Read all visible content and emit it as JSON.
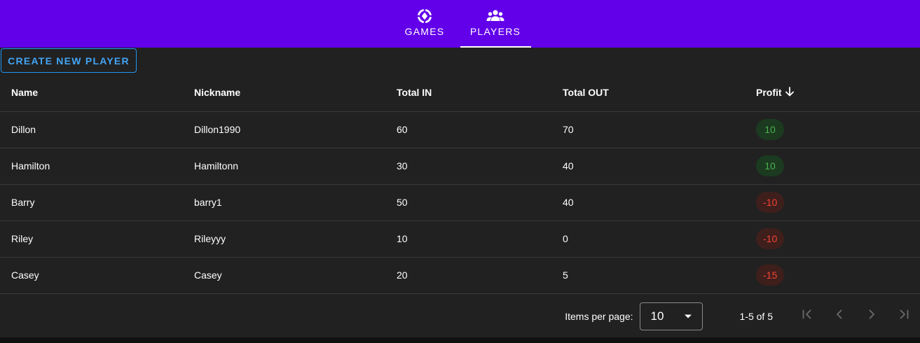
{
  "nav": {
    "tabs": [
      {
        "label": "GAMES",
        "icon": "poker-chip-icon",
        "active": false
      },
      {
        "label": "PLAYERS",
        "icon": "people-icon",
        "active": true
      }
    ]
  },
  "toolbar": {
    "create_label": "CREATE NEW PLAYER"
  },
  "table": {
    "columns": [
      "Name",
      "Nickname",
      "Total IN",
      "Total OUT",
      "Profit"
    ],
    "sort": {
      "column": "Profit",
      "direction": "descending",
      "icon": "arrow-down-icon"
    },
    "rows": [
      {
        "name": "Dillon",
        "nickname": "Dillon1990",
        "total_in": "60",
        "total_out": "70",
        "profit": "10",
        "status": "positive"
      },
      {
        "name": "Hamilton",
        "nickname": "Hamiltonn",
        "total_in": "30",
        "total_out": "40",
        "profit": "10",
        "status": "positive"
      },
      {
        "name": "Barry",
        "nickname": "barry1",
        "total_in": "50",
        "total_out": "40",
        "profit": "-10",
        "status": "negative"
      },
      {
        "name": "Riley",
        "nickname": "Rileyyy",
        "total_in": "10",
        "total_out": "0",
        "profit": "-10",
        "status": "negative"
      },
      {
        "name": "Casey",
        "nickname": "Casey",
        "total_in": "20",
        "total_out": "5",
        "profit": "-15",
        "status": "negative"
      }
    ]
  },
  "pagination": {
    "items_per_page_label": "Items per page:",
    "page_size": "10",
    "range_label": "1-5 of 5",
    "buttons": [
      "first-page-icon",
      "previous-page-icon",
      "next-page-icon",
      "last-page-icon"
    ]
  },
  "colors": {
    "app_bar": "#6200ea",
    "accent": "#2196f3",
    "positive": "#4caf50",
    "negative": "#f44336",
    "surface": "#212121"
  }
}
